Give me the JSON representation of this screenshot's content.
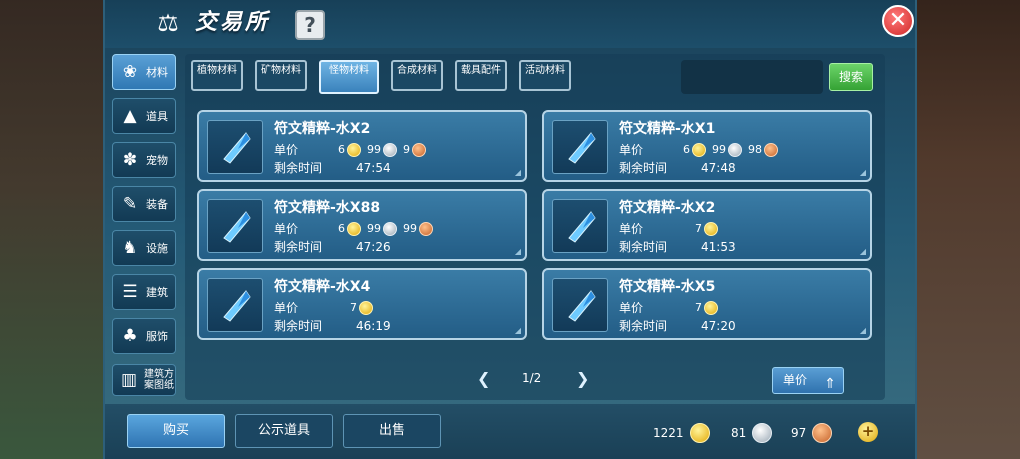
{
  "window": {
    "title": "交易所",
    "help": "?",
    "close": "✕"
  },
  "sidebar": {
    "items": [
      {
        "label": "材料",
        "icon": "materials-icon",
        "glyph": "❀"
      },
      {
        "label": "道具",
        "icon": "flask-icon",
        "glyph": "▲"
      },
      {
        "label": "宠物",
        "icon": "paw-icon",
        "glyph": "✽"
      },
      {
        "label": "装备",
        "icon": "sword-icon",
        "glyph": "✎"
      },
      {
        "label": "设施",
        "icon": "facility-icon",
        "glyph": "♞"
      },
      {
        "label": "建筑",
        "icon": "building-icon",
        "glyph": "☰"
      },
      {
        "label": "服饰",
        "icon": "clothing-icon",
        "glyph": "♣"
      },
      {
        "label": "建筑方案图纸",
        "icon": "blueprint-icon",
        "glyph": "▥"
      }
    ],
    "active_index": 0
  },
  "tabs": [
    {
      "label": "植物材料"
    },
    {
      "label": "矿物材料"
    },
    {
      "label": "怪物材料"
    },
    {
      "label": "合成材料"
    },
    {
      "label": "载具配件"
    },
    {
      "label": "活动材料"
    }
  ],
  "active_tab": 2,
  "search": {
    "value": "",
    "button": "搜索"
  },
  "listings": [
    {
      "name": "符文精粹-水X2",
      "price_label": "单价",
      "gold": "6",
      "silver": "99",
      "bronze": "9",
      "time_label": "剩余时间",
      "time": "47:54"
    },
    {
      "name": "符文精粹-水X1",
      "price_label": "单价",
      "gold": "6",
      "silver": "99",
      "bronze": "98",
      "time_label": "剩余时间",
      "time": "47:48"
    },
    {
      "name": "符文精粹-水X88",
      "price_label": "单价",
      "gold": "6",
      "silver": "99",
      "bronze": "99",
      "time_label": "剩余时间",
      "time": "47:26"
    },
    {
      "name": "符文精粹-水X2",
      "price_label": "单价",
      "gold": "7",
      "silver": "",
      "bronze": "",
      "time_label": "剩余时间",
      "time": "41:53"
    },
    {
      "name": "符文精粹-水X4",
      "price_label": "单价",
      "gold": "7",
      "silver": "",
      "bronze": "",
      "time_label": "剩余时间",
      "time": "46:19"
    },
    {
      "name": "符文精粹-水X5",
      "price_label": "单价",
      "gold": "7",
      "silver": "",
      "bronze": "",
      "time_label": "剩余时间",
      "time": "47:20"
    }
  ],
  "pagination": {
    "page": "1/2"
  },
  "sort": {
    "label": "单价"
  },
  "actions": {
    "buy": "购买",
    "public": "公示道具",
    "sell": "出售"
  },
  "wallet": {
    "gold": "1221",
    "silver": "81",
    "bronze": "97"
  },
  "colors": {
    "accent": "#3a82bc",
    "search": "#35a234",
    "close": "#d02828",
    "gold": "#e2a908",
    "silver": "#9aa8b4",
    "bronze": "#c5622a"
  }
}
